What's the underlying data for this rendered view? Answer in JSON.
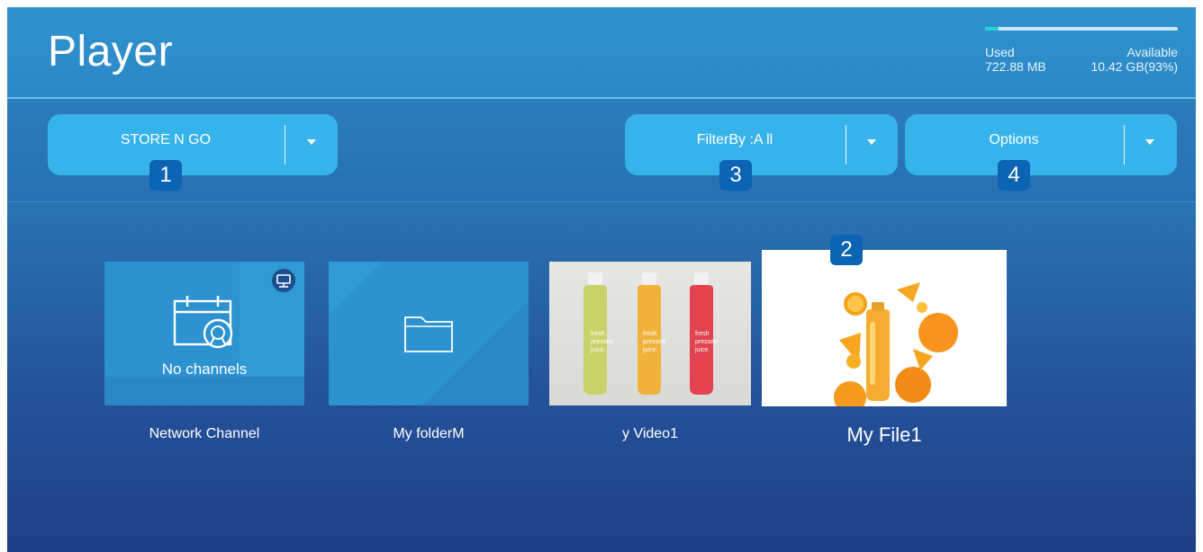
{
  "header": {
    "title": "Player",
    "storage": {
      "used_label": "Used",
      "used_value": "722.88 MB",
      "available_label": "Available",
      "available_value": "10.42 GB(93%)",
      "used_fraction": 0.07
    }
  },
  "controls": {
    "source": {
      "label": "STORE N GO",
      "badge": "1"
    },
    "filter": {
      "label": "FilterBy :A ll",
      "badge": "3"
    },
    "options": {
      "label": "Options",
      "badge": "4"
    }
  },
  "content": {
    "selected_badge": "2",
    "items": [
      {
        "caption": "Network Channel",
        "tile_text": "No channels",
        "icon": "calendar-channel-icon"
      },
      {
        "caption": "My folderM",
        "icon": "folder-icon"
      },
      {
        "caption": "y Video1",
        "bottles": [
          "fresh",
          "pressed",
          "juice."
        ]
      },
      {
        "caption": "My File1"
      }
    ]
  },
  "colors": {
    "accent": "#37b3ec",
    "badge": "#0c64b5",
    "storage_fill": "#1fd2d6"
  }
}
